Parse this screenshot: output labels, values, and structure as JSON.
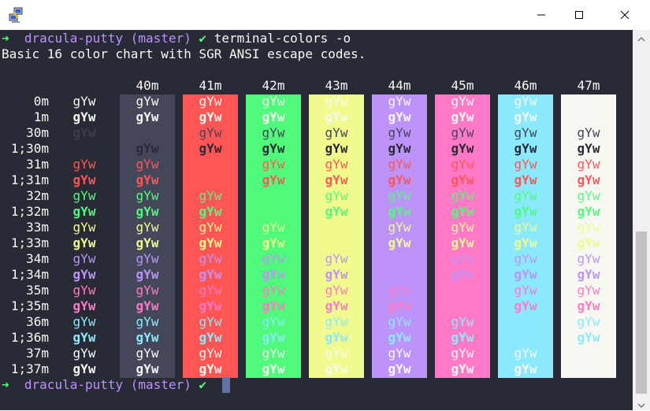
{
  "window": {
    "controls": {
      "minimize": "minimize-icon",
      "maximize": "maximize-icon",
      "close": "close-icon"
    }
  },
  "prompt": {
    "arrow": "➜",
    "dir": "dracula-putty",
    "branch": "(master)",
    "check": "✔"
  },
  "command": "terminal-colors -o",
  "description": "Basic 16 color chart with SGR ANSI escape codes.",
  "chart": {
    "sample": "gYw",
    "bg_headers": [
      "40m",
      "41m",
      "42m",
      "43m",
      "44m",
      "45m",
      "46m",
      "47m"
    ],
    "bg_colors": [
      "#44475a",
      "#ff5555",
      "#50fa7b",
      "#f1fa8c",
      "#bd93f9",
      "#ff79c6",
      "#8be9fd",
      "#f8f8f2"
    ],
    "term_bg": "#282a36",
    "rows": [
      {
        "label": "0m",
        "fg": "#f8f8f2"
      },
      {
        "label": "1m",
        "fg": "#f8f8f2"
      },
      {
        "label": "30m",
        "fg": "#44475a"
      },
      {
        "label": "1;30m",
        "fg": "#282a36"
      },
      {
        "label": "31m",
        "fg": "#ff5555"
      },
      {
        "label": "1;31m",
        "fg": "#ff5555"
      },
      {
        "label": "32m",
        "fg": "#50fa7b"
      },
      {
        "label": "1;32m",
        "fg": "#50fa7b"
      },
      {
        "label": "33m",
        "fg": "#f1fa8c"
      },
      {
        "label": "1;33m",
        "fg": "#f1fa8c"
      },
      {
        "label": "34m",
        "fg": "#bd93f9"
      },
      {
        "label": "1;34m",
        "fg": "#bd93f9"
      },
      {
        "label": "35m",
        "fg": "#ff79c6"
      },
      {
        "label": "1;35m",
        "fg": "#ff79c6"
      },
      {
        "label": "36m",
        "fg": "#8be9fd"
      },
      {
        "label": "1;36m",
        "fg": "#8be9fd"
      },
      {
        "label": "37m",
        "fg": "#f8f8f2"
      },
      {
        "label": "1;37m",
        "fg": "#f8f8f2"
      }
    ]
  }
}
